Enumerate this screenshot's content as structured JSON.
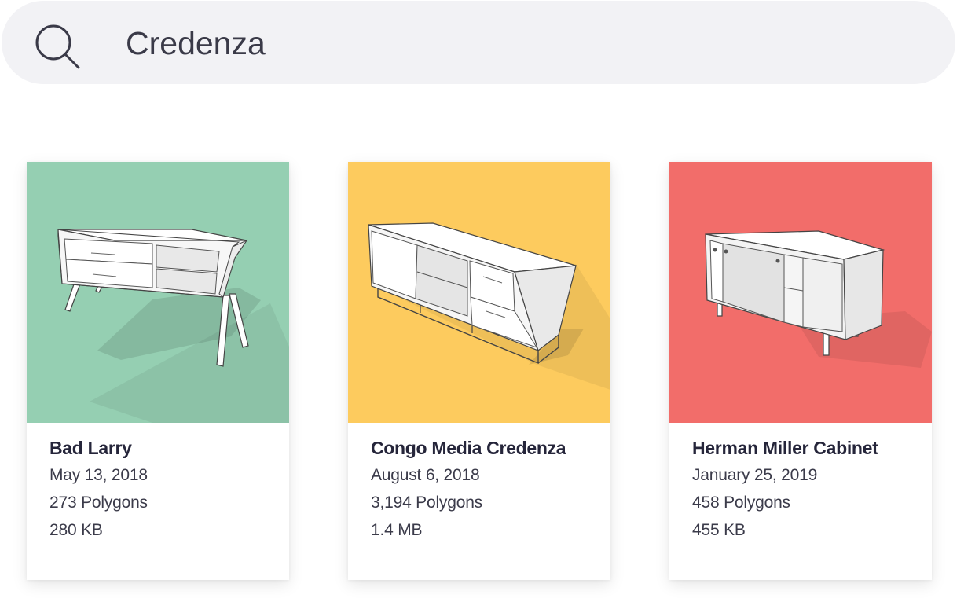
{
  "search": {
    "value": "Credenza",
    "icon": "search-icon"
  },
  "results": [
    {
      "title": "Bad Larry",
      "date": "May 13, 2018",
      "polygons": "273 Polygons",
      "size": "280 KB",
      "color": "#95cfb2"
    },
    {
      "title": "Congo Media Credenza",
      "date": "August 6, 2018",
      "polygons": "3,194 Polygons",
      "size": "1.4 MB",
      "color": "#fdcb5e"
    },
    {
      "title": "Herman Miller Cabinet",
      "date": "January 25, 2019",
      "polygons": "458 Polygons",
      "size": "455 KB",
      "color": "#f26d6a"
    }
  ]
}
